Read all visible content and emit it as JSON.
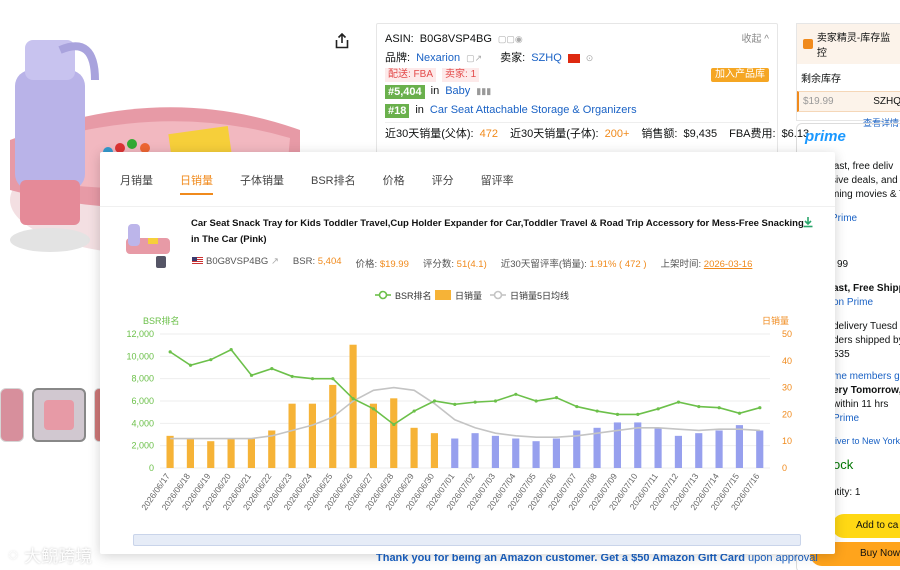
{
  "listing": {
    "asin_label": "ASIN:",
    "asin": "B0G8VSP4BG",
    "collapse": "收起",
    "brand_label": "品牌:",
    "brand": "Nexarion",
    "seller_label": "卖家:",
    "seller": "SZHQ",
    "fulfillment_tag": "配送: FBA",
    "seller_count_tag": "卖家: 1",
    "add_to_pool": "加入产品库",
    "rank_main": "#5,404",
    "rank_main_in": "in",
    "rank_main_cat": "Baby",
    "rank_sub": "#18",
    "rank_sub_in": "in",
    "rank_sub_cat": "Car Seat Attachable Storage & Organizers",
    "sales_parent_label": "近30天销量(父体):",
    "sales_parent": "472",
    "sales_child_label": "近30天销量(子体):",
    "sales_child": "200+",
    "revenue_label": "销售额:",
    "revenue": "$9,435",
    "fba_label": "FBA费用:",
    "fba": "$6.13"
  },
  "seller_widget": {
    "title": "卖家精灵-库存监控",
    "remaining_label": "剩余库存",
    "price": "$19.99",
    "seller": "SZHQ",
    "detail_link": "查看详情"
  },
  "buy_box": {
    "prime": "prime",
    "line1": "fast, free deliv",
    "line2": "sive deals, and a",
    "line3": "ming movies & TV",
    "line4": "Prime",
    "price_cents": "99",
    "line5": "ast, Free Shipp",
    "line6": "on Prime",
    "line7": "delivery Tuesd",
    "line8": "ders shipped by",
    "line9": "535",
    "line10": "me members g",
    "line11": "ery Tomorrow,",
    "line12": "within 11 hrs",
    "line13": "Prime",
    "line14": "liver to New York",
    "stock": "ock",
    "qty_label": "ntity:",
    "qty": "1",
    "add_to_cart": "Add to ca",
    "buy_now": "Buy Now"
  },
  "footer": {
    "text": "Thank you for being an Amazon customer. Get a $50 Amazon Gift Card",
    "tail": "upon approval"
  },
  "watermark": "大鲵跨境",
  "overlay": {
    "tabs": [
      "月销量",
      "日销量",
      "子体销量",
      "BSR排名",
      "价格",
      "评分",
      "留评率"
    ],
    "active_tab": 1,
    "product_title": "Car Seat Snack Tray for Kids Toddler Travel,Cup Holder Expander for Car,Toddler Travel & Road Trip Accessory for Mess-Free Snacking in The Car (Pink)",
    "meta": {
      "asin": "B0G8VSP4BG",
      "bsr_label": "BSR:",
      "bsr": "5,404",
      "price_label": "价格:",
      "price": "$19.99",
      "ratings_label": "评分数:",
      "ratings": "51(4.1)",
      "review_rate_label": "近30天留评率(销量):",
      "review_rate": "1.91% ( 472 )",
      "launch_label": "上架时间:",
      "launch": "2026-03-16"
    }
  },
  "colors": {
    "accent": "#f08a1c",
    "bsr_line": "#6cc04a",
    "bar_orange": "#f6b337",
    "bar_blue": "#97a0ee",
    "ma_line": "#c4c4c4"
  },
  "chart_data": {
    "type": "bar",
    "legend": [
      "BSR排名",
      "日销量",
      "日销量5日均线"
    ],
    "legend_position": "top-center",
    "ylabel_left": "BSR排名",
    "ylabel_right": "日销量",
    "yticks_left": [
      "0",
      "2,000",
      "4,000",
      "6,000",
      "8,000",
      "10,000",
      "12,000"
    ],
    "yticks_right": [
      "0",
      "10",
      "20",
      "30",
      "40",
      "50"
    ],
    "ylim_left": [
      0,
      12000
    ],
    "ylim_right": [
      0,
      50
    ],
    "grid": true,
    "categories": [
      "2026/06/17",
      "2026/06/18",
      "2026/06/19",
      "2026/06/20",
      "2026/06/21",
      "2026/06/22",
      "2026/06/23",
      "2026/06/24",
      "2026/06/25",
      "2026/06/26",
      "2026/06/27",
      "2026/06/28",
      "2026/06/29",
      "2026/06/30",
      "2026/07/01",
      "2026/07/02",
      "2026/07/03",
      "2026/07/04",
      "2026/07/05",
      "2026/07/06",
      "2026/07/07",
      "2026/07/08",
      "2026/07/09",
      "2026/07/10",
      "2026/07/11",
      "2026/07/12",
      "2026/07/13",
      "2026/07/14",
      "2026/07/15",
      "2026/07/16"
    ],
    "series": [
      {
        "name": "日销量",
        "axis": "right",
        "values": [
          12,
          11,
          10,
          11,
          11,
          14,
          24,
          24,
          31,
          46,
          24,
          26,
          15,
          13,
          11,
          13,
          12,
          11,
          10,
          11,
          14,
          15,
          17,
          17,
          15,
          12,
          13,
          14,
          16,
          14
        ],
        "forecast_from_index": 14
      },
      {
        "name": "BSR排名",
        "axis": "left",
        "values": [
          10400,
          9200,
          9700,
          10600,
          8300,
          8900,
          8200,
          8000,
          8000,
          6200,
          5300,
          3900,
          5100,
          6000,
          5700,
          5900,
          6000,
          6600,
          6000,
          6300,
          5500,
          5100,
          4800,
          4800,
          5300,
          5900,
          5500,
          5400,
          4900,
          5400
        ]
      },
      {
        "name": "日销量5日均线",
        "axis": "right",
        "values": [
          11,
          11,
          11,
          11,
          11,
          12,
          14,
          16,
          19,
          25,
          29,
          30,
          29,
          24,
          18,
          15,
          13,
          12,
          11.5,
          11.5,
          12,
          13,
          14,
          15,
          15,
          14.5,
          14,
          14.5,
          14.5,
          14
        ]
      }
    ]
  }
}
